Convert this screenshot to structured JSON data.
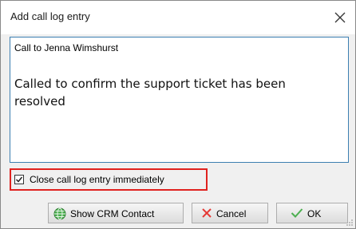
{
  "dialog": {
    "title": "Add call log entry",
    "close_icon": "close-icon"
  },
  "memo": {
    "subject": "Call to Jenna Wimshurst",
    "body": "Called to confirm the support ticket has been resolved"
  },
  "options": {
    "close_immediately_label": "Close call log entry immediately",
    "close_immediately_checked": true,
    "highlight_color": "#e0221f"
  },
  "buttons": {
    "crm": {
      "label": "Show CRM Contact",
      "icon": "globe-icon"
    },
    "cancel": {
      "label": "Cancel",
      "icon": "x-icon"
    },
    "ok": {
      "label": "OK",
      "icon": "checkmark-icon"
    }
  }
}
